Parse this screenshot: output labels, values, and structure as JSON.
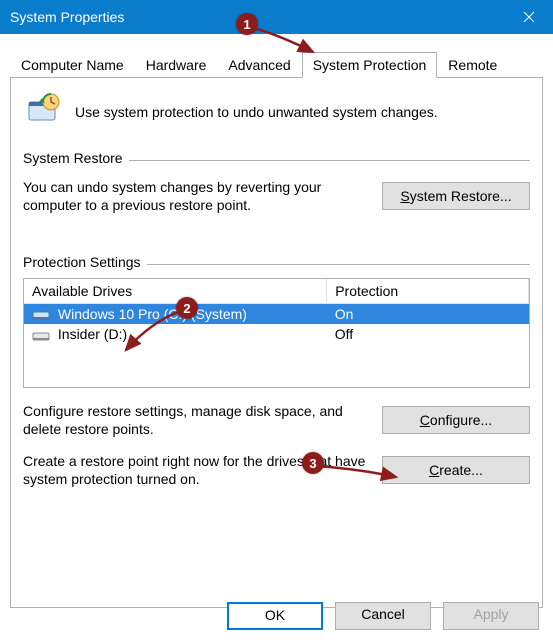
{
  "title": "System Properties",
  "tabs": [
    "Computer Name",
    "Hardware",
    "Advanced",
    "System Protection",
    "Remote"
  ],
  "active_tab_index": 3,
  "info_text": "Use system protection to undo unwanted system changes.",
  "group_restore": {
    "title": "System Restore",
    "text": "You can undo system changes by reverting your computer to a previous restore point.",
    "button_prefix": "S",
    "button_rest": "ystem Restore..."
  },
  "group_protection": {
    "title": "Protection Settings",
    "col_drives": "Available Drives",
    "col_protection": "Protection",
    "rows": [
      {
        "name": "Windows 10 Pro (C:) (System)",
        "protection": "On",
        "selected": true
      },
      {
        "name": "Insider (D:)",
        "protection": "Off",
        "selected": false
      }
    ],
    "config_text": "Configure restore settings, manage disk space, and delete restore points.",
    "config_btn_prefix": "C",
    "config_btn_rest": "onfigure...",
    "create_text": "Create a restore point right now for the drives that have system protection turned on.",
    "create_btn_prefix": "C",
    "create_btn_rest": "reate..."
  },
  "footer": {
    "ok": "OK",
    "cancel": "Cancel",
    "apply": "Apply"
  },
  "annotations": {
    "one": "1",
    "two": "2",
    "three": "3"
  }
}
